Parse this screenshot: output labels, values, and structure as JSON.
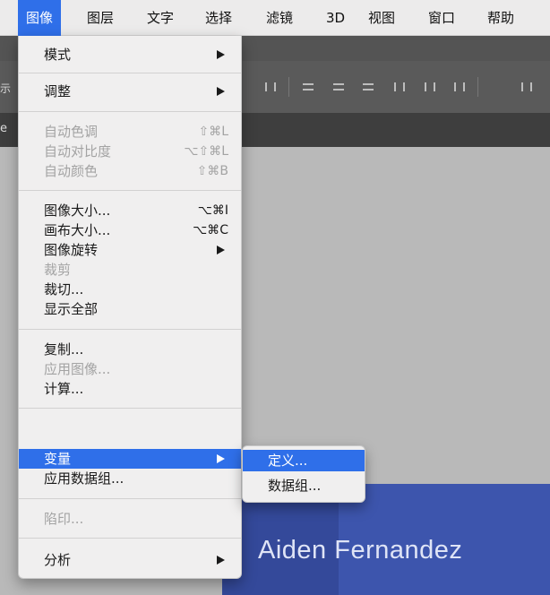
{
  "menubar": {
    "items": [
      {
        "label": "图像",
        "active": true
      },
      {
        "label": "图层"
      },
      {
        "label": "文字"
      },
      {
        "label": "选择"
      },
      {
        "label": "滤镜"
      },
      {
        "label": "3D"
      },
      {
        "label": "视图"
      },
      {
        "label": "窗口"
      },
      {
        "label": "帮助"
      }
    ]
  },
  "background": {
    "options_edge_text": "示",
    "tab_edge_text": "e",
    "banner_text": "Aiden Fernandez",
    "colors": {
      "menubar": "#ecebeb",
      "highlight": "#2f6fe9",
      "canvas": "#b9b9b9",
      "banner": "#3d55ad"
    }
  },
  "image_menu": {
    "items": [
      {
        "label": "模式",
        "has_submenu": true
      },
      {
        "label": "调整",
        "has_submenu": true
      },
      {
        "label": "自动色调",
        "shortcut": "⇧⌘L",
        "disabled": true
      },
      {
        "label": "自动对比度",
        "shortcut": "⌥⇧⌘L",
        "disabled": true
      },
      {
        "label": "自动颜色",
        "shortcut": "⇧⌘B",
        "disabled": true
      },
      {
        "label": "图像大小...",
        "shortcut": "⌥⌘I"
      },
      {
        "label": "画布大小...",
        "shortcut": "⌥⌘C"
      },
      {
        "label": "图像旋转",
        "has_submenu": true
      },
      {
        "label": "裁剪",
        "disabled": true
      },
      {
        "label": "裁切..."
      },
      {
        "label": "显示全部"
      },
      {
        "label": "复制..."
      },
      {
        "label": "应用图像...",
        "disabled": true
      },
      {
        "label": "计算..."
      },
      {
        "label": "变量",
        "has_submenu": true,
        "highlighted": true
      },
      {
        "label": "应用数据组..."
      },
      {
        "label": "陷印...",
        "disabled": true
      },
      {
        "label": "分析",
        "has_submenu": true
      }
    ]
  },
  "variables_submenu": {
    "items": [
      {
        "label": "定义...",
        "highlighted": true
      },
      {
        "label": "数据组..."
      }
    ]
  }
}
